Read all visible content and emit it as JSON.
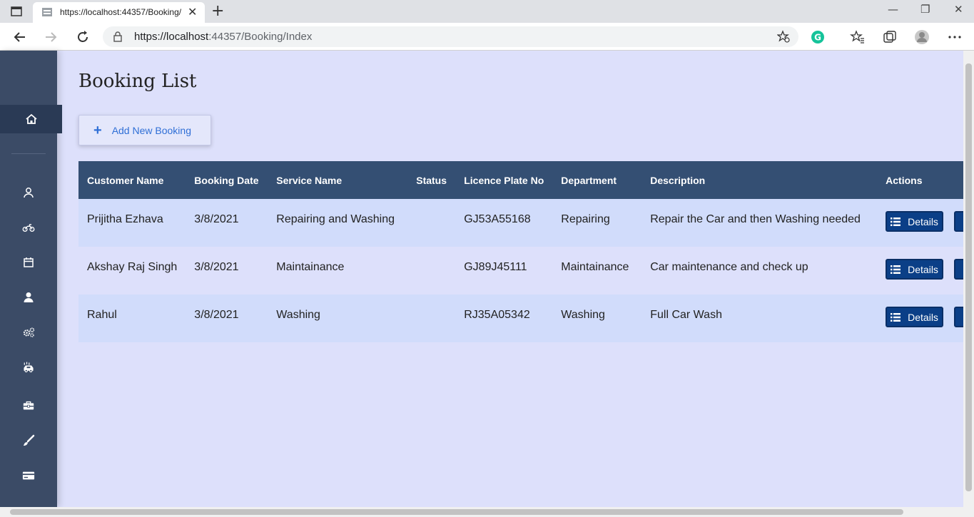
{
  "browser": {
    "tab_title": "https://localhost:44357/Booking/",
    "url_host": "https://localhost",
    "url_rest": ":44357/Booking/Index",
    "new_tab": "+",
    "close_tab": "✕",
    "minimize": "—",
    "restore": "❐",
    "close_window": "✕",
    "extension_color": "#15c39a"
  },
  "sidebar": {
    "items": [
      {
        "icon": "home-icon",
        "active": true
      },
      {
        "icon": "user-outline-icon"
      },
      {
        "icon": "motorcycle-icon"
      },
      {
        "icon": "calendar-icon"
      },
      {
        "icon": "user-icon"
      },
      {
        "icon": "gears-icon"
      },
      {
        "icon": "car-wash-icon"
      },
      {
        "icon": "toolbox-icon"
      },
      {
        "icon": "brush-icon"
      },
      {
        "icon": "credit-card-icon"
      }
    ]
  },
  "main": {
    "title": "Booking List",
    "add_button": "Add New Booking",
    "add_icon": "+"
  },
  "table": {
    "columns": [
      "Customer Name",
      "Booking Date",
      "Service Name",
      "Status",
      "Licence Plate No",
      "Department",
      "Description",
      "Actions"
    ],
    "details_label": "Details",
    "rows": [
      {
        "customer": "Prijitha Ezhava",
        "date": "3/8/2021",
        "service": "Repairing and Washing",
        "status": "",
        "plate": "GJ53A55168",
        "department": "Repairing",
        "description": "Repair the Car and then Washing needed"
      },
      {
        "customer": "Akshay Raj Singh",
        "date": "3/8/2021",
        "service": "Maintainance",
        "status": "",
        "plate": "GJ89J45111",
        "department": "Maintainance",
        "description": "Car maintenance and check up"
      },
      {
        "customer": "Rahul",
        "date": "3/8/2021",
        "service": "Washing",
        "status": "",
        "plate": "RJ35A05342",
        "department": "Washing",
        "description": "Full Car Wash"
      }
    ]
  },
  "colors": {
    "header_bg": "#344f73",
    "sidebar_bg": "#3b4b66",
    "button_bg": "#0b3f87",
    "page_bg": "#dde0fb",
    "row_alt": "#d1dcfb"
  }
}
